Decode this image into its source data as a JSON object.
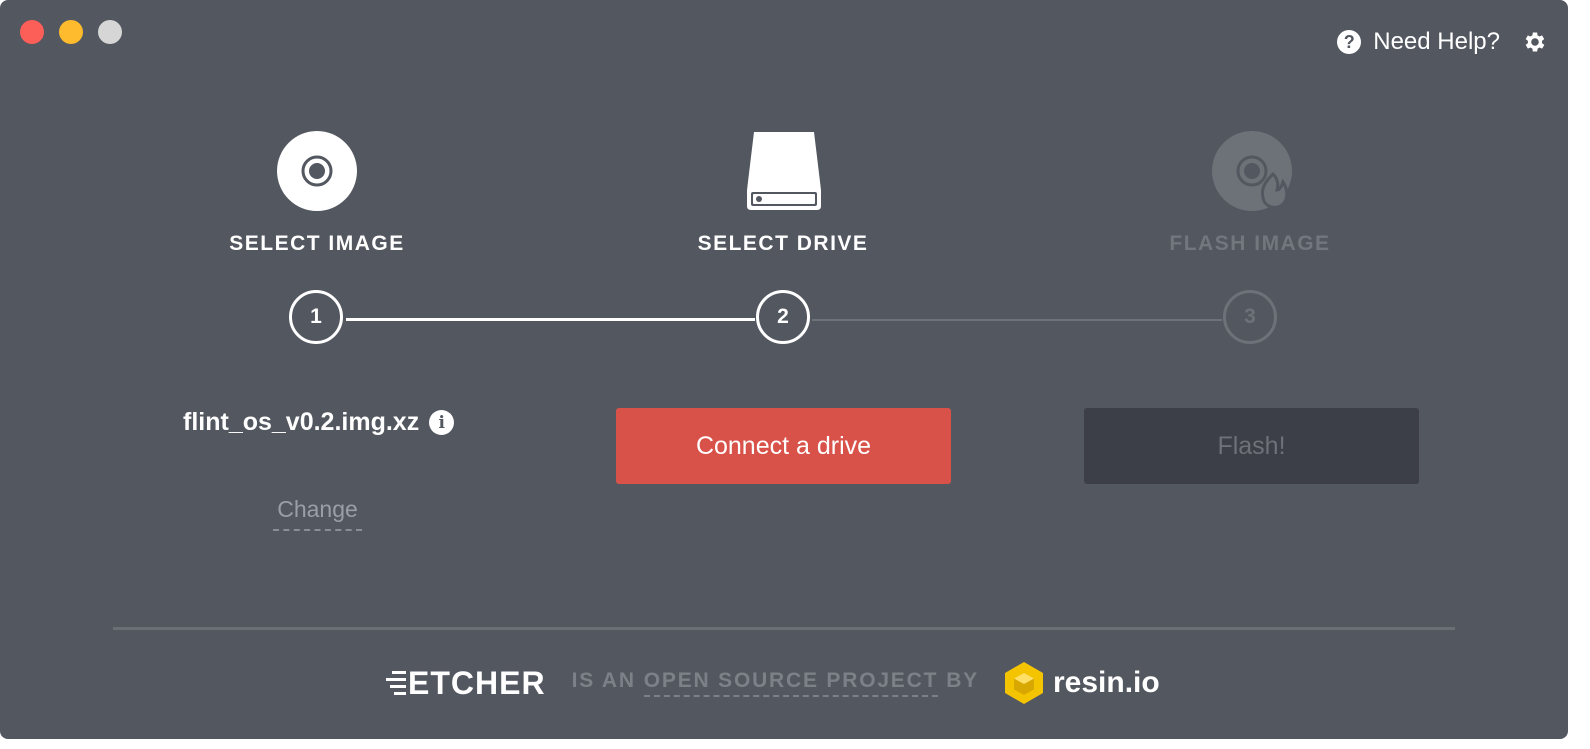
{
  "window": {
    "controls": [
      "close",
      "minimize",
      "maximize"
    ]
  },
  "header": {
    "help_label": "Need Help?",
    "help_icon": "question-circle-icon",
    "settings_icon": "gear-icon"
  },
  "steps": [
    {
      "title": "SELECT IMAGE",
      "number": "1",
      "icon": "disc-icon",
      "state": "completed"
    },
    {
      "title": "SELECT DRIVE",
      "number": "2",
      "icon": "drive-icon",
      "state": "active"
    },
    {
      "title": "FLASH IMAGE",
      "number": "3",
      "icon": "flash-disc-icon",
      "state": "disabled"
    }
  ],
  "image": {
    "filename": "flint_os_v0.2.img.xz",
    "info_icon": "info-icon",
    "change_label": "Change"
  },
  "drive": {
    "button_label": "Connect a drive"
  },
  "flash": {
    "button_label": "Flash!"
  },
  "footer": {
    "brand": "ETCHER",
    "text_prefix": "IS AN",
    "link_text": "OPEN SOURCE PROJECT",
    "text_suffix": "BY",
    "company": "resin.io"
  },
  "colors": {
    "background": "#535760",
    "accent": "#d9524a",
    "disabled_button": "#3c3f47",
    "resin_yellow": "#f5c400"
  }
}
